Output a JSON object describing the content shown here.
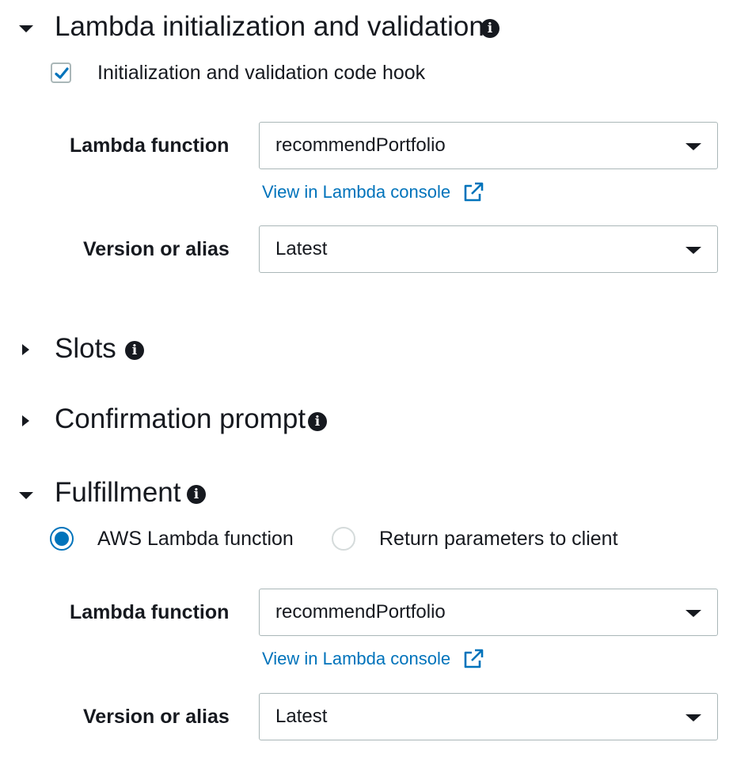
{
  "sections": {
    "lambda_init": {
      "title": "Lambda initialization and validation",
      "expanded": true,
      "checkbox_label": "Initialization and validation code hook",
      "checked": true,
      "lambda_function_label": "Lambda function",
      "lambda_function_value": "recommendPortfolio",
      "console_link": "View in Lambda console",
      "version_label": "Version or alias",
      "version_value": "Latest"
    },
    "slots": {
      "title": "Slots",
      "expanded": false
    },
    "confirmation": {
      "title": "Confirmation prompt",
      "expanded": false
    },
    "fulfillment": {
      "title": "Fulfillment",
      "expanded": true,
      "radio_options": [
        "AWS Lambda function",
        "Return parameters to client"
      ],
      "selected_option": "AWS Lambda function",
      "lambda_function_label": "Lambda function",
      "lambda_function_value": "recommendPortfolio",
      "console_link": "View in Lambda console",
      "version_label": "Version or alias",
      "version_value": "Latest"
    }
  },
  "icons": {
    "info": "info-icon",
    "external_link": "external-link-icon",
    "expand": "caret-icon",
    "dropdown": "chevron-down-icon"
  },
  "colors": {
    "link": "#0073bb",
    "radio_selected": "#0073bb",
    "text": "#16191f"
  }
}
